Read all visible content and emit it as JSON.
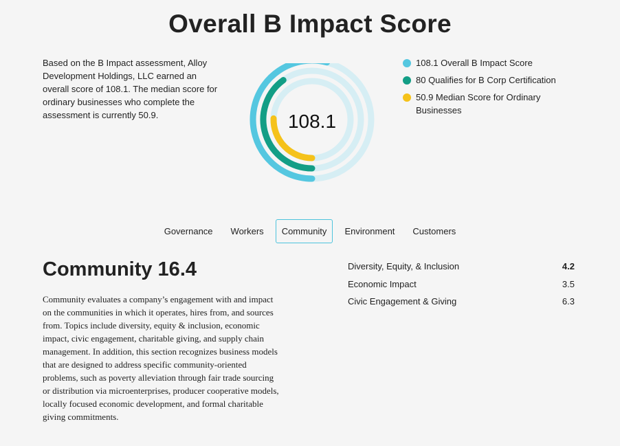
{
  "page": {
    "title": "Overall B Impact Score",
    "intro": "Based on the B Impact assessment, Alloy Development Holdings, LLC earned an overall score of 108.1. The median score for ordinary businesses who complete the assessment is currently 50.9."
  },
  "score": {
    "center_label": "108.1"
  },
  "colors": {
    "overall": "#55c7e0",
    "certification": "#139e86",
    "median": "#f5c21a",
    "track": "#d6eef4",
    "active_tab_border": "#4cc3dc"
  },
  "legend": [
    {
      "label": "108.1 Overall B Impact Score",
      "color": "#55c7e0"
    },
    {
      "label": "80 Qualifies for B Corp Certification",
      "color": "#139e86"
    },
    {
      "label": "50.9 Median Score for Ordinary Businesses",
      "color": "#f5c21a"
    }
  ],
  "chart_data": {
    "type": "radial-bar",
    "max": 200,
    "series": [
      {
        "name": "Overall B Impact Score",
        "value": 108.1
      },
      {
        "name": "Qualifies for B Corp Certification",
        "value": 80
      },
      {
        "name": "Median Score for Ordinary Businesses",
        "value": 50.9
      }
    ]
  },
  "tabs": [
    {
      "label": "Governance",
      "active": false
    },
    {
      "label": "Workers",
      "active": false
    },
    {
      "label": "Community",
      "active": true
    },
    {
      "label": "Environment",
      "active": false
    },
    {
      "label": "Customers",
      "active": false
    }
  ],
  "section": {
    "title": "Community 16.4",
    "description": "Community evaluates a company’s engagement with and impact on the communities in which it operates, hires from, and sources from. Topics include diversity, equity & inclusion, economic impact, civic engagement, charitable giving, and supply chain management. In addition, this section recognizes business models that are designed to address specific community-oriented problems, such as poverty alleviation through fair trade sourcing or distribution via microenterprises, producer cooperative models, locally focused economic development, and formal charitable giving commitments."
  },
  "subscores": [
    {
      "label": "Diversity, Equity, & Inclusion",
      "value": "4.2"
    },
    {
      "label": "Economic Impact",
      "value": "3.5"
    },
    {
      "label": "Civic Engagement & Giving",
      "value": "6.3"
    }
  ]
}
